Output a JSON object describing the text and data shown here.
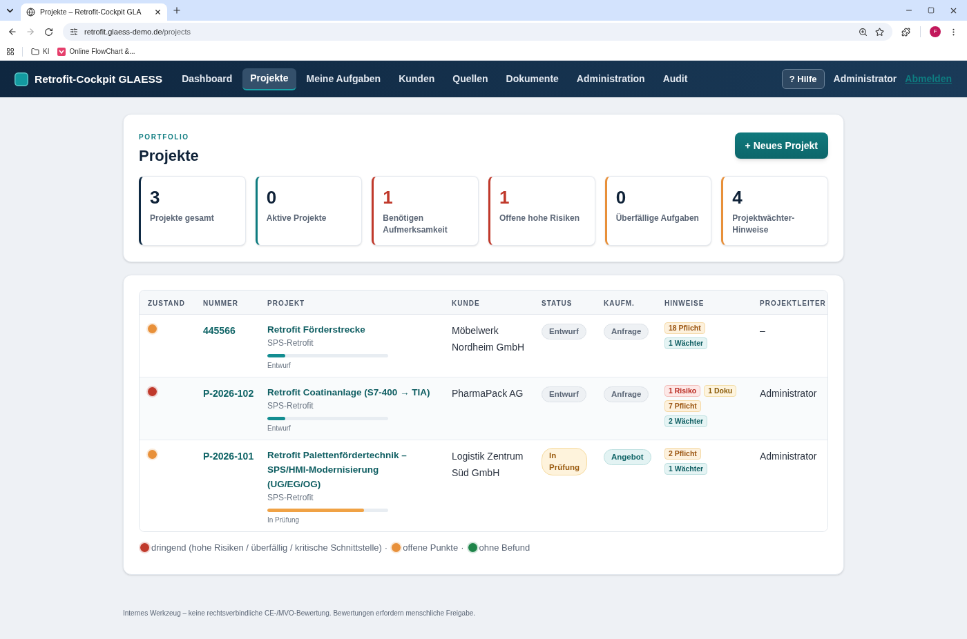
{
  "browser": {
    "tab_title": "Projekte – Retrofit-Cockpit GLA",
    "url": {
      "host": "retrofit.glaess-demo.de",
      "path": "/projects"
    },
    "bookmarks": [
      {
        "kind": "folder",
        "label": "KI"
      },
      {
        "kind": "site",
        "label": "Online FlowChart &..."
      }
    ],
    "profile_initial": "F"
  },
  "app_nav": {
    "brand": "Retrofit-Cockpit GLAESS",
    "items": [
      {
        "label": "Dashboard",
        "selected": false
      },
      {
        "label": "Projekte",
        "selected": true
      },
      {
        "label": "Meine Aufgaben",
        "selected": false
      },
      {
        "label": "Kunden",
        "selected": false
      },
      {
        "label": "Quellen",
        "selected": false
      },
      {
        "label": "Dokumente",
        "selected": false
      },
      {
        "label": "Administration",
        "selected": false
      },
      {
        "label": "Audit",
        "selected": false
      }
    ],
    "help": "? Hilfe",
    "user": "Administrator",
    "logout": "Abmelden"
  },
  "header": {
    "eyebrow": "PORTFOLIO",
    "title": "Projekte",
    "new_button": "+ Neues Projekt"
  },
  "kpis": [
    {
      "value": "3",
      "label": "Projekte gesamt",
      "color": "#0f2a44",
      "kind": "plain"
    },
    {
      "value": "0",
      "label": "Aktive Projekte",
      "color": "#0e7c80",
      "kind": "plain"
    },
    {
      "value": "1",
      "label": "Benötigen Aufmerksamkeit",
      "color": "#c0392b",
      "kind": "alert"
    },
    {
      "value": "1",
      "label": "Offene hohe Risiken",
      "color": "#c0392b",
      "kind": "alert"
    },
    {
      "value": "0",
      "label": "Überfällige Aufgaben",
      "color": "#e8903a",
      "kind": "plain"
    },
    {
      "value": "4",
      "label": "Projektwächter-Hinweise",
      "color": "#e8903a",
      "kind": "plain"
    }
  ],
  "table": {
    "columns": [
      "ZUSTAND",
      "NUMMER",
      "PROJEKT",
      "KUNDE",
      "STATUS",
      "KAUFM.",
      "HINWEISE",
      "PROJEKTLEITER"
    ],
    "rows": [
      {
        "color": "#e8903a",
        "number": "445566",
        "project": {
          "title": "Retrofit Förderstrecke",
          "type": "SPS-Retrofit",
          "progress": {
            "level": 0.15,
            "label": "Entwurf",
            "kind": "draft"
          }
        },
        "customer": "Möbelwerk Nordheim GmbH",
        "status": {
          "label": "Entwurf",
          "kind": "neutral"
        },
        "commercial": {
          "label": "Anfrage",
          "kind": "neutral"
        },
        "hints": [
          {
            "label": "18 Pflicht",
            "kind": "pflicht"
          },
          {
            "label": "1 Wächter",
            "kind": "waechter"
          }
        ],
        "lead": "–"
      },
      {
        "color": "#c0392b",
        "number": "P-2026-102",
        "project": {
          "title": "Retrofit Coatinanlage (S7-400 → TIA)",
          "type": "SPS-Retrofit",
          "progress": {
            "level": 0.15,
            "label": "Entwurf",
            "kind": "draft"
          }
        },
        "customer": "PharmaPack AG",
        "status": {
          "label": "Entwurf",
          "kind": "neutral"
        },
        "commercial": {
          "label": "Anfrage",
          "kind": "neutral"
        },
        "hints": [
          {
            "label": "1 Risiko",
            "kind": "risiko"
          },
          {
            "label": "1 Doku",
            "kind": "doku"
          },
          {
            "label": "7 Pflicht",
            "kind": "pflicht"
          },
          {
            "label": "2 Wächter",
            "kind": "waechter"
          }
        ],
        "lead": "Administrator"
      },
      {
        "color": "#e8903a",
        "number": "P-2026-101",
        "project": {
          "title": "Retrofit Palettenfördertechnik – SPS/HMI-Modernisierung (UG/EG/OG)",
          "type": "SPS-Retrofit",
          "progress": {
            "level": 0.8,
            "label": "In Prüfung",
            "kind": "review"
          }
        },
        "customer": "Logistik Zentrum Süd GmbH",
        "status": {
          "label": "In Prüfung",
          "kind": "review"
        },
        "commercial": {
          "label": "Angebot",
          "kind": "offer"
        },
        "hints": [
          {
            "label": "2 Pflicht",
            "kind": "pflicht"
          },
          {
            "label": "1 Wächter",
            "kind": "waechter"
          }
        ],
        "lead": "Administrator"
      }
    ]
  },
  "legend": {
    "items": [
      {
        "label": "dringend (hohe Risiken / überfällig / kritische Schnittstelle)",
        "color": "#c0392b",
        "separator": "·"
      },
      {
        "label": "offene Punkte",
        "color": "#e8903a",
        "separator": "·"
      },
      {
        "label": "ohne Befund",
        "color": "#1e8449"
      }
    ]
  },
  "footer": "Internes Werkzeug – keine rechtsverbindliche CE-/MVO-Bewertung. Bewertungen erfordern menschliche Freigabe."
}
